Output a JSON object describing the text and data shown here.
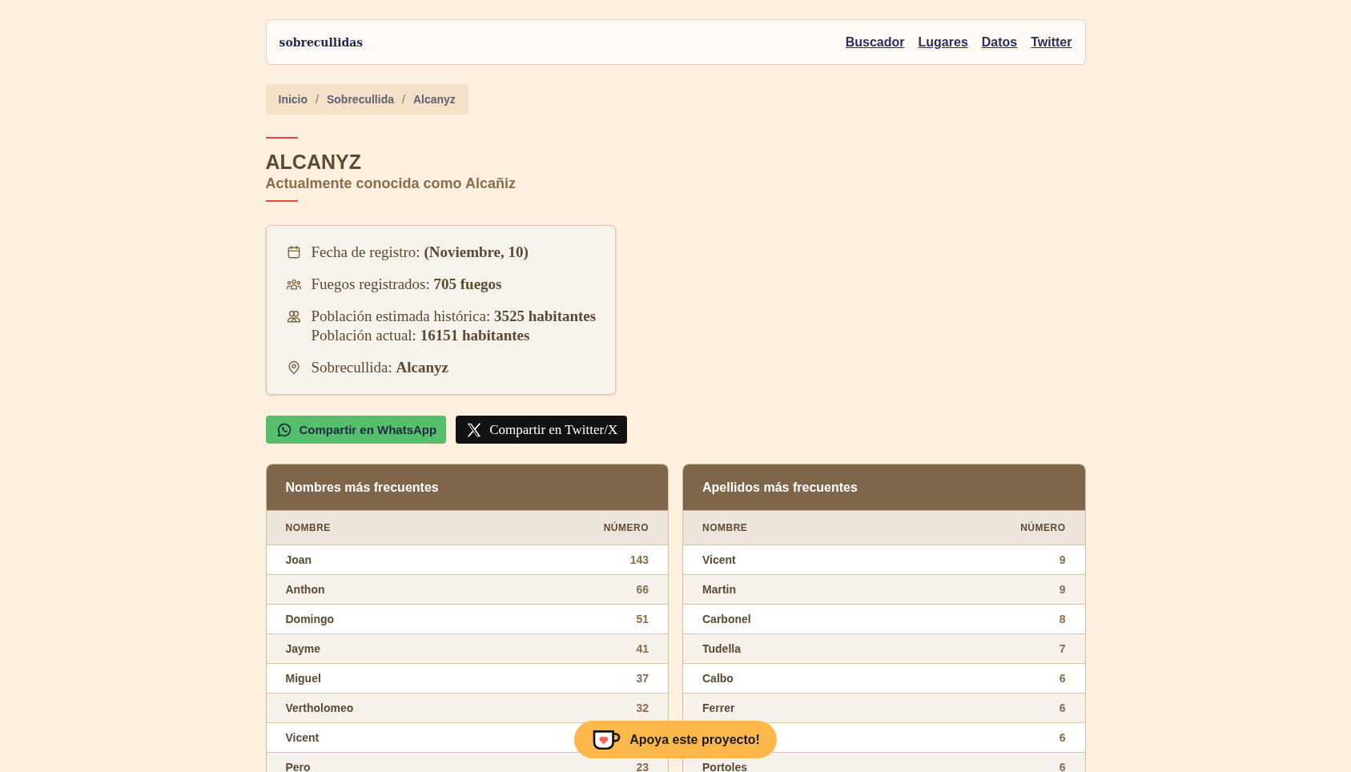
{
  "header": {
    "logo": "sobrecullidas",
    "links": [
      "Buscador",
      "Lugares",
      "Datos",
      "Twitter"
    ]
  },
  "breadcrumb": {
    "separator": "/",
    "items": [
      "Inicio",
      "Sobrecullida",
      "Alcanyz"
    ]
  },
  "title": "ALCANYZ",
  "subtitle": "Actualmente conocida como Alcañiz",
  "info": [
    {
      "kind": "calendar",
      "lines": [
        "Fecha de registro: **(Noviembre, 10)**"
      ]
    },
    {
      "kind": "people",
      "lines": [
        "Fuegos registrados: **705 fuegos**"
      ]
    },
    {
      "kind": "group",
      "lines": [
        "Población estimada histórica: **3525 habitantes**",
        "Población actual: **16151 habitantes**"
      ]
    },
    {
      "kind": "pin",
      "lines": [
        "Sobrecullida: **Alcanyz**"
      ]
    }
  ],
  "share": [
    {
      "kind": "whatsapp",
      "label": "Compartir en WhatsApp"
    },
    {
      "kind": "x",
      "label": "Compartir en Twitter/X"
    }
  ],
  "tables": [
    {
      "title": "Nombres más frecuentes",
      "columns": [
        "NOMBRE",
        "NÚMERO"
      ],
      "rows": [
        {
          "name": "Joan",
          "count": "143"
        },
        {
          "name": "Anthon",
          "count": "66"
        },
        {
          "name": "Domingo",
          "count": "51"
        },
        {
          "name": "Jayme",
          "count": "41"
        },
        {
          "name": "Miguel",
          "count": "37"
        },
        {
          "name": "Vertholomeo",
          "count": "32"
        },
        {
          "name": "Vicent"
        },
        {
          "name": "Pero",
          "count": "23"
        }
      ]
    },
    {
      "title": "Apellidos más frecuentes",
      "columns": [
        "NOMBRE",
        "NÚMERO"
      ],
      "rows": [
        {
          "name": "Vicent",
          "count": "9"
        },
        {
          "name": "Martin",
          "count": "9"
        },
        {
          "name": "Carbonel",
          "count": "8"
        },
        {
          "name": "Tudella",
          "count": "7"
        },
        {
          "name": "Calbo",
          "count": "6"
        },
        {
          "name": "Ferrer",
          "count": "6"
        },
        {
          "count": "6"
        },
        {
          "name": "Portoles",
          "count": "6"
        }
      ]
    }
  ],
  "support": {
    "label": "Apoya este proyecto!"
  }
}
